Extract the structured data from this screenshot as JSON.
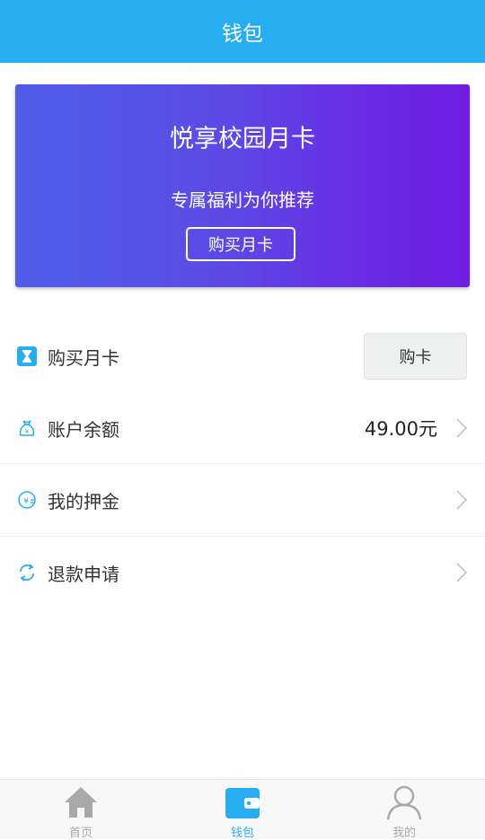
{
  "header": {
    "title": "钱包"
  },
  "banner": {
    "title": "悦享校园月卡",
    "subtitle": "专属福利为你推荐",
    "button_label": "购买月卡"
  },
  "list": {
    "buy_card": {
      "label": "购买月卡",
      "button_label": "购卡",
      "icon": "hourglass-icon"
    },
    "balance": {
      "label": "账户余额",
      "value": "49.00元",
      "icon": "money-bag-icon"
    },
    "deposit": {
      "label": "我的押金",
      "icon": "deposit-icon"
    },
    "refund": {
      "label": "退款申请",
      "icon": "refresh-icon"
    }
  },
  "tabs": [
    {
      "label": "首页",
      "icon": "home-icon",
      "active": false
    },
    {
      "label": "钱包",
      "icon": "wallet-icon",
      "active": true
    },
    {
      "label": "我的",
      "icon": "user-icon",
      "active": false
    }
  ],
  "colors": {
    "accent": "#27aef0",
    "inactive": "#a8a8a8"
  }
}
